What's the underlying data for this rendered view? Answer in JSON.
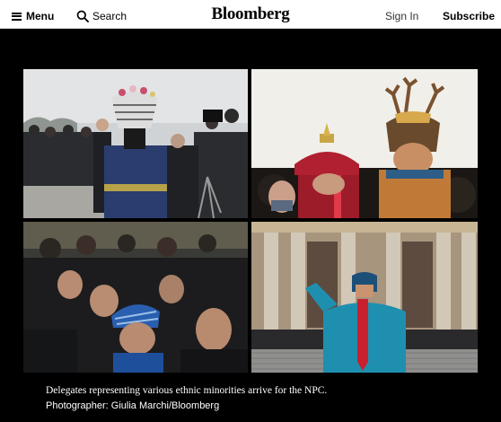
{
  "header": {
    "menu_label": "Menu",
    "search_label": "Search",
    "logo": "Bloomberg",
    "signin_label": "Sign In",
    "subscribe_label": "Subscribe"
  },
  "gallery": {
    "caption": "Delegates representing various ethnic minorities arrive for the NPC.",
    "credit": "Photographer: Giulia Marchi/Bloomberg"
  },
  "icons": {
    "menu": "hamburger-icon",
    "search": "search-icon"
  },
  "colors": {
    "page_background": "#ffffff",
    "stage_background": "#000000",
    "text_primary": "#000000",
    "caption_text": "#ffffff"
  }
}
